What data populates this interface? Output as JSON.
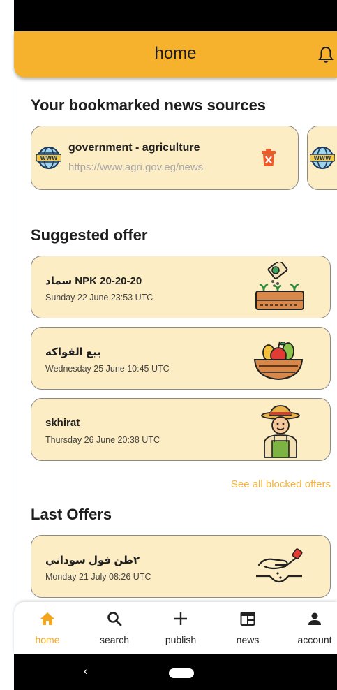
{
  "app_bar": {
    "title": "home"
  },
  "bookmarks": {
    "title": "Your bookmarked news sources",
    "items": [
      {
        "name": "government - agriculture",
        "url": "https://www.agri.gov.eg/news"
      }
    ]
  },
  "suggested": {
    "title": "Suggested offer",
    "offers": [
      {
        "title": "سماد NPK 20-20-20",
        "date": "Sunday 22 June 23:53 UTC"
      },
      {
        "title": "بيع الفواكه",
        "date": "Wednesday 25 June 10:45 UTC"
      },
      {
        "title": "skhirat",
        "date": "Thursday 26 June 20:38 UTC"
      }
    ],
    "see_all": "See all blocked offers"
  },
  "last_offers": {
    "title": "Last Offers",
    "offers": [
      {
        "title": "٢طن فول سوداني",
        "date": "Monday 21 July 08:26 UTC"
      }
    ]
  },
  "nav": {
    "items": [
      {
        "label": "home",
        "icon": "home-icon",
        "active": true
      },
      {
        "label": "search",
        "icon": "search-icon"
      },
      {
        "label": "publish",
        "icon": "plus-icon"
      },
      {
        "label": "news",
        "icon": "news-icon"
      },
      {
        "label": "account",
        "icon": "person-icon"
      }
    ]
  },
  "colors": {
    "accent": "#f7b22d",
    "card": "#fdedc4",
    "delete": "#f05a28"
  }
}
